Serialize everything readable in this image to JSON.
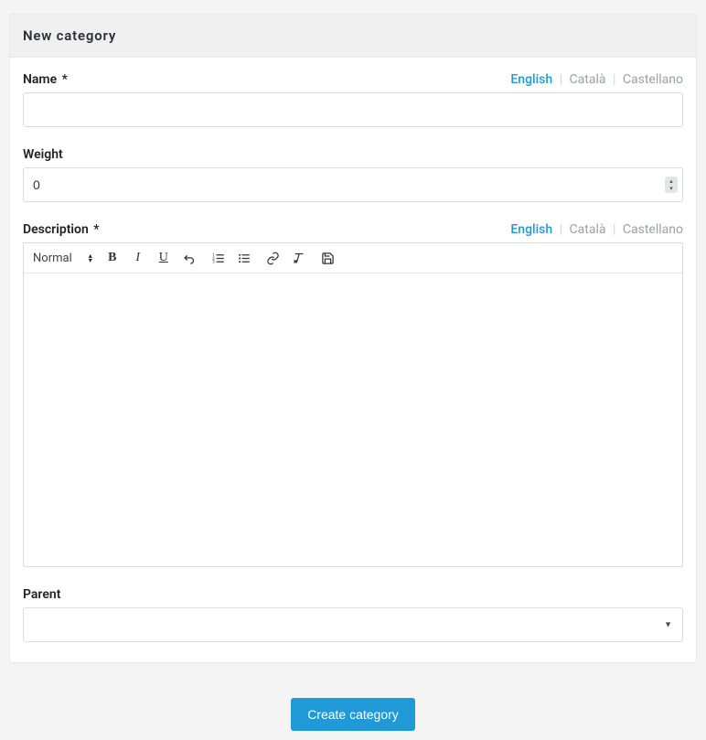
{
  "card": {
    "title": "New category"
  },
  "locales": {
    "items": [
      "English",
      "Català",
      "Castellano"
    ],
    "active_index": 0
  },
  "fields": {
    "name": {
      "label": "Name",
      "required_mark": "*",
      "value": ""
    },
    "weight": {
      "label": "Weight",
      "value": "0"
    },
    "description": {
      "label": "Description",
      "required_mark": "*",
      "value": ""
    },
    "parent": {
      "label": "Parent",
      "value": ""
    }
  },
  "toolbar": {
    "format_label": "Normal",
    "icons": {
      "bold": "bold",
      "italic": "italic",
      "underline": "underline",
      "return": "return",
      "ol": "ordered-list",
      "ul": "bullet-list",
      "link": "link",
      "clear": "clear-format",
      "save": "save"
    }
  },
  "actions": {
    "submit_label": "Create category"
  }
}
